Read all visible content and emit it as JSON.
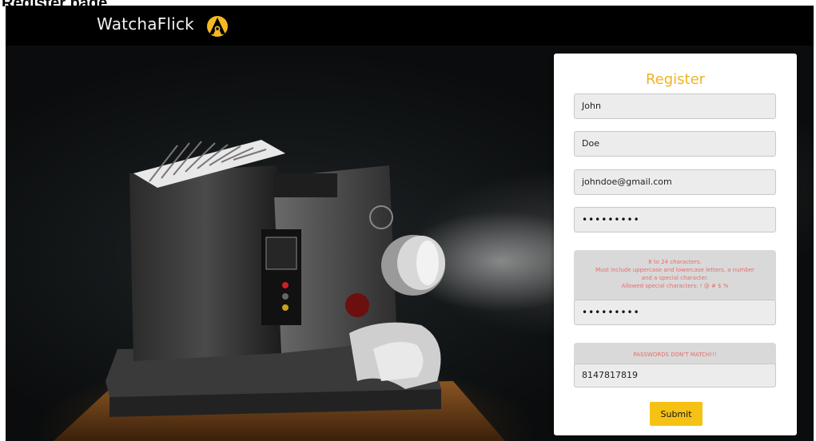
{
  "caption": "Register page",
  "nav": {
    "brand": "WatchaFlick",
    "logo_icon": "watchaflick-logo-icon"
  },
  "form": {
    "title": "Register",
    "first_name": "John",
    "last_name": "Doe",
    "email": "johndoe@gmail.com",
    "password_mask": "•••••••••",
    "password_hint_lines": [
      "8 to 24 characters.",
      "Must include uppercase and lowercase letters, a number",
      "and a special character.",
      "Allowed special characters: ! @ # $ %"
    ],
    "confirm_mask": "•••••••••",
    "match_error": "PASSWORDS DON'T MATCH!!!",
    "phone": "8147817819",
    "submit_label": "Submit"
  },
  "colors": {
    "accent": "#f0b323",
    "button": "#f5c214",
    "error": "#e86c6c"
  }
}
